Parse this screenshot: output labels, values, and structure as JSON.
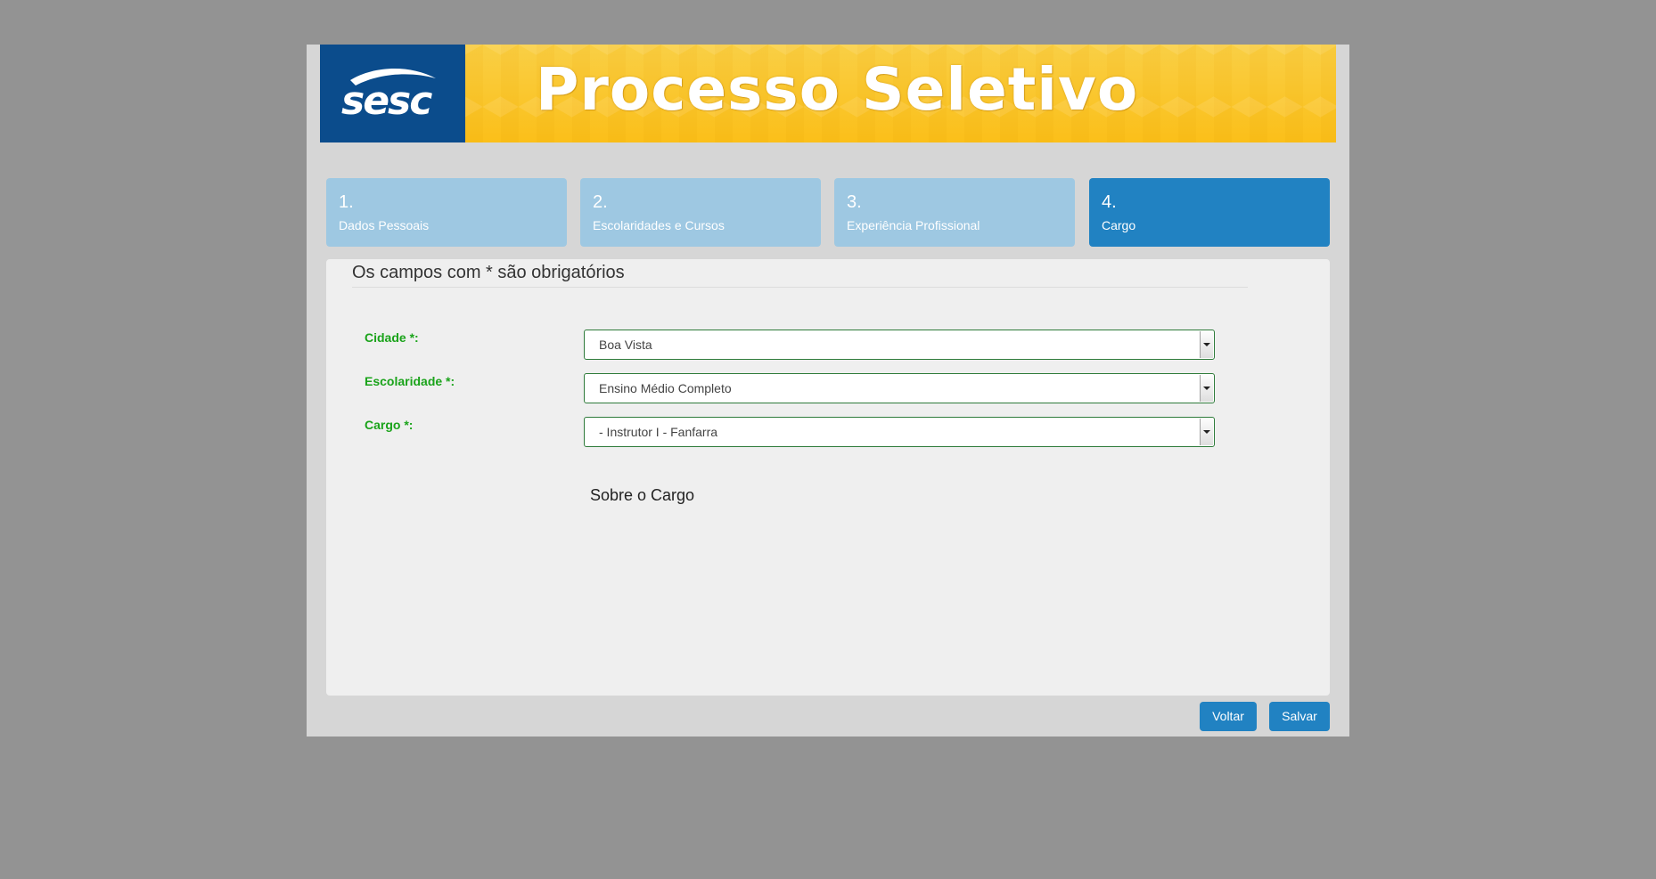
{
  "banner": {
    "logo_text": "sesc",
    "title": "Processo Seletivo"
  },
  "steps": [
    {
      "number": "1.",
      "label": "Dados Pessoais"
    },
    {
      "number": "2.",
      "label": "Escolaridades e Cursos"
    },
    {
      "number": "3.",
      "label": "Experiência Profissional"
    },
    {
      "number": "4.",
      "label": "Cargo",
      "active": true
    }
  ],
  "form": {
    "heading": "Os campos com * são obrigatórios",
    "fields": [
      {
        "label": "Cidade *:",
        "value": "Boa Vista"
      },
      {
        "label": "Escolaridade *:",
        "value": "Ensino Médio Completo"
      },
      {
        "label": "Cargo *:",
        "value": "- Instrutor I - Fanfarra"
      }
    ],
    "about_title": "Sobre o Cargo"
  },
  "actions": {
    "back_label": "Voltar",
    "save_label": "Salvar"
  },
  "colors": {
    "brand_blue": "#0b4c8c",
    "banner_yellow": "#fcc528",
    "step_inactive": "#9ec8e2",
    "step_active": "#2182c2",
    "label_green": "#1aa31a",
    "button_blue": "#2182c2"
  }
}
